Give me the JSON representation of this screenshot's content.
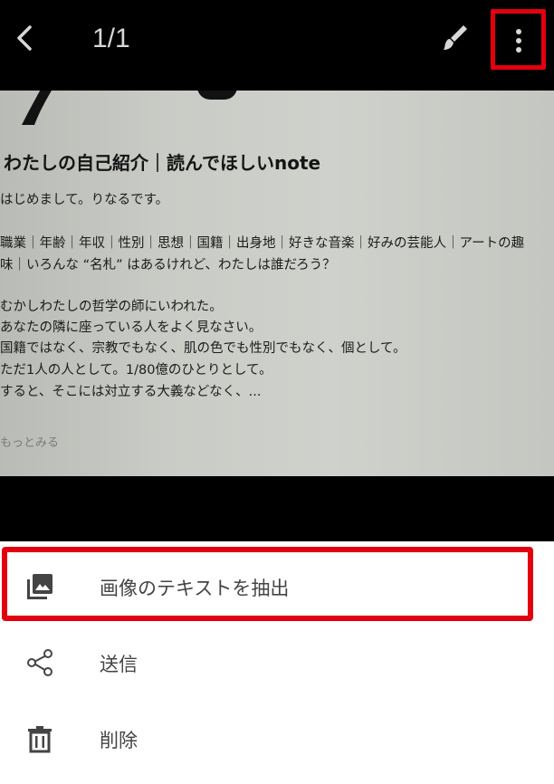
{
  "toolbar": {
    "back_icon": "chevron-left-icon",
    "page_counter": "1/1",
    "edit_icon": "brush-icon",
    "more_icon": "more-vert-icon"
  },
  "photo": {
    "title": "わたしの自己紹介｜読んでほしいnote",
    "lines": [
      "はじめまして。りなるです。",
      "",
      "職業｜年齢｜年収｜性別｜思想｜国籍｜出身地｜好きな音楽｜好みの芸能人｜アートの趣",
      "味｜いろんな “名札” はあるけれど、わたしは誰だろう？",
      "",
      "むかしわたしの哲学の師にいわれた。",
      "あなたの隣に座っている人をよく見なさい。",
      "国籍ではなく、宗教でもなく、肌の色でも性別でもなく、個として。",
      "ただ1人の人として。1/80億のひとりとして。",
      "すると、そこには対立する大義などなく、..."
    ],
    "more_link": "もっとみる"
  },
  "menu": {
    "items": [
      {
        "label": "画像のテキストを抽出",
        "icon": "image-text-icon"
      },
      {
        "label": "送信",
        "icon": "share-icon"
      },
      {
        "label": "削除",
        "icon": "trash-icon"
      }
    ]
  },
  "colors": {
    "highlight": "#e3000f",
    "toolbar_bg": "#000000",
    "sheet_bg": "#ffffff"
  }
}
